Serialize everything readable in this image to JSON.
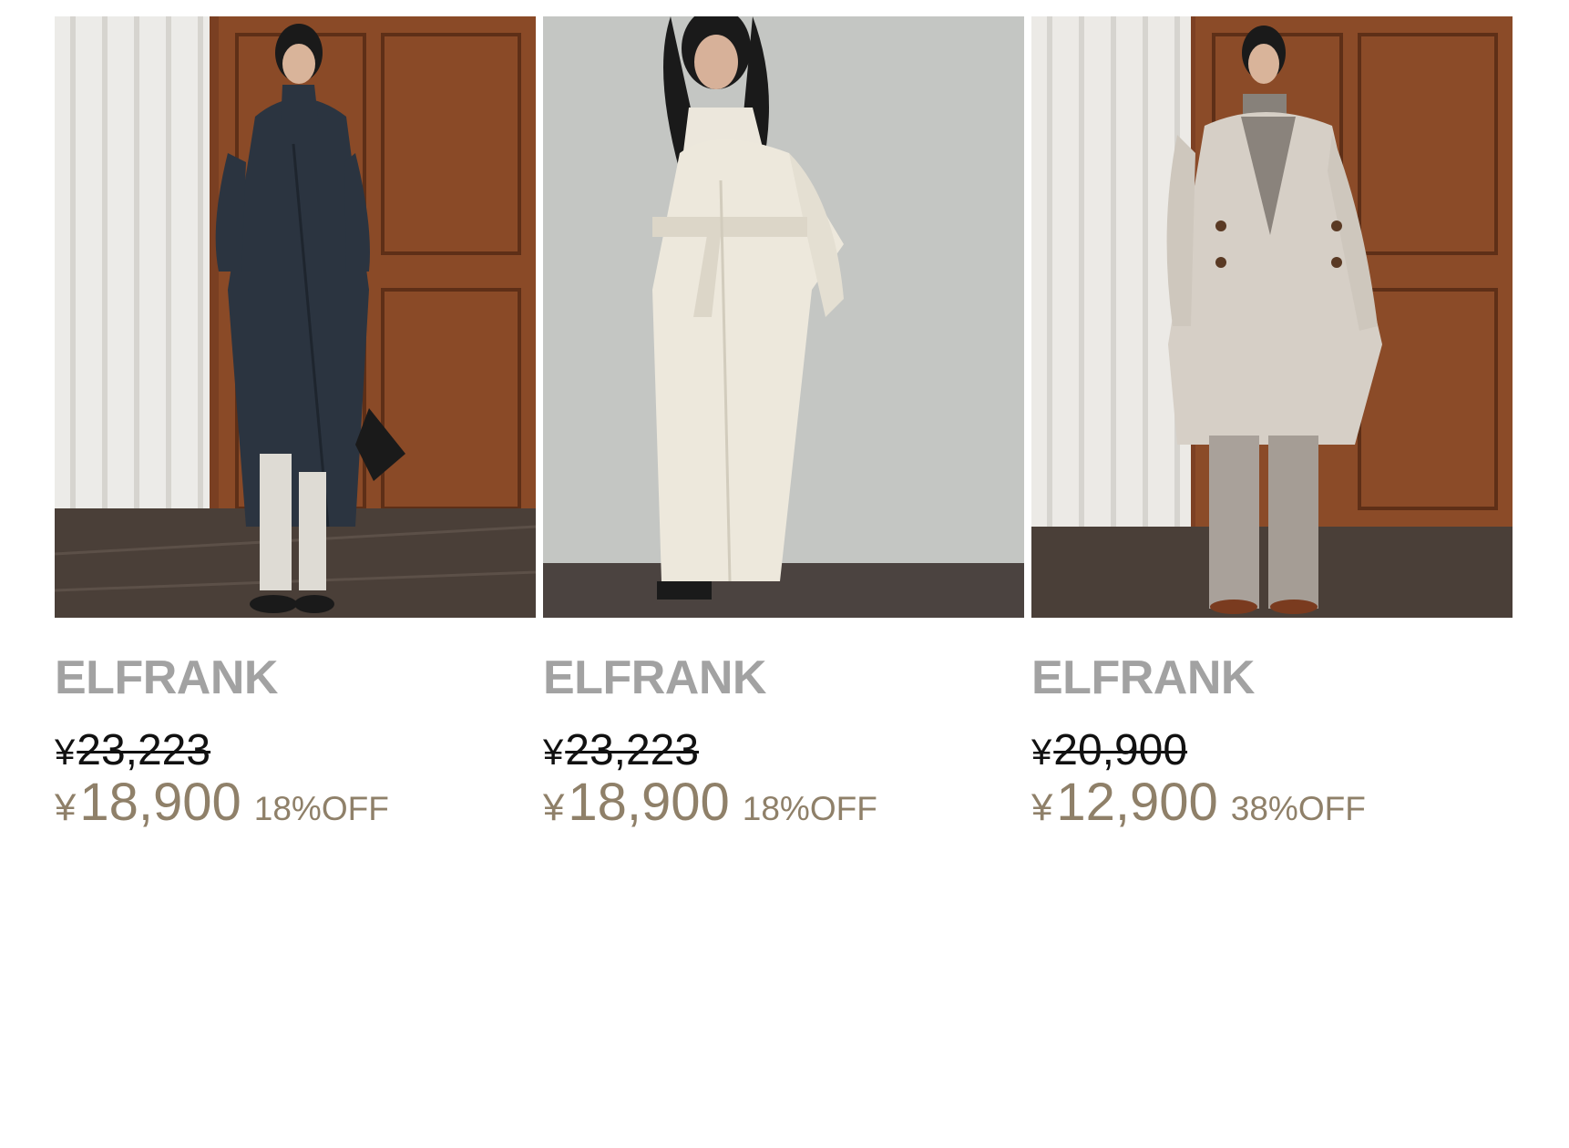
{
  "products": [
    {
      "image_alt": "navy long coat",
      "brand": "ELFRANK",
      "original_currency": "¥",
      "original_price": "23,223",
      "sale_currency": "¥",
      "sale_price": "18,900",
      "discount": "18%OFF"
    },
    {
      "image_alt": "ivory belted long coat",
      "brand": "ELFRANK",
      "original_currency": "¥",
      "original_price": "23,223",
      "sale_currency": "¥",
      "sale_price": "18,900",
      "discount": "18%OFF"
    },
    {
      "image_alt": "beige double-breasted coat",
      "brand": "ELFRANK",
      "original_currency": "¥",
      "original_price": "20,900",
      "sale_currency": "¥",
      "sale_price": "12,900",
      "discount": "38%OFF"
    }
  ],
  "colors": {
    "brand_text": "#a2a2a2",
    "original_price": "#111111",
    "sale_price": "#8f8069"
  }
}
